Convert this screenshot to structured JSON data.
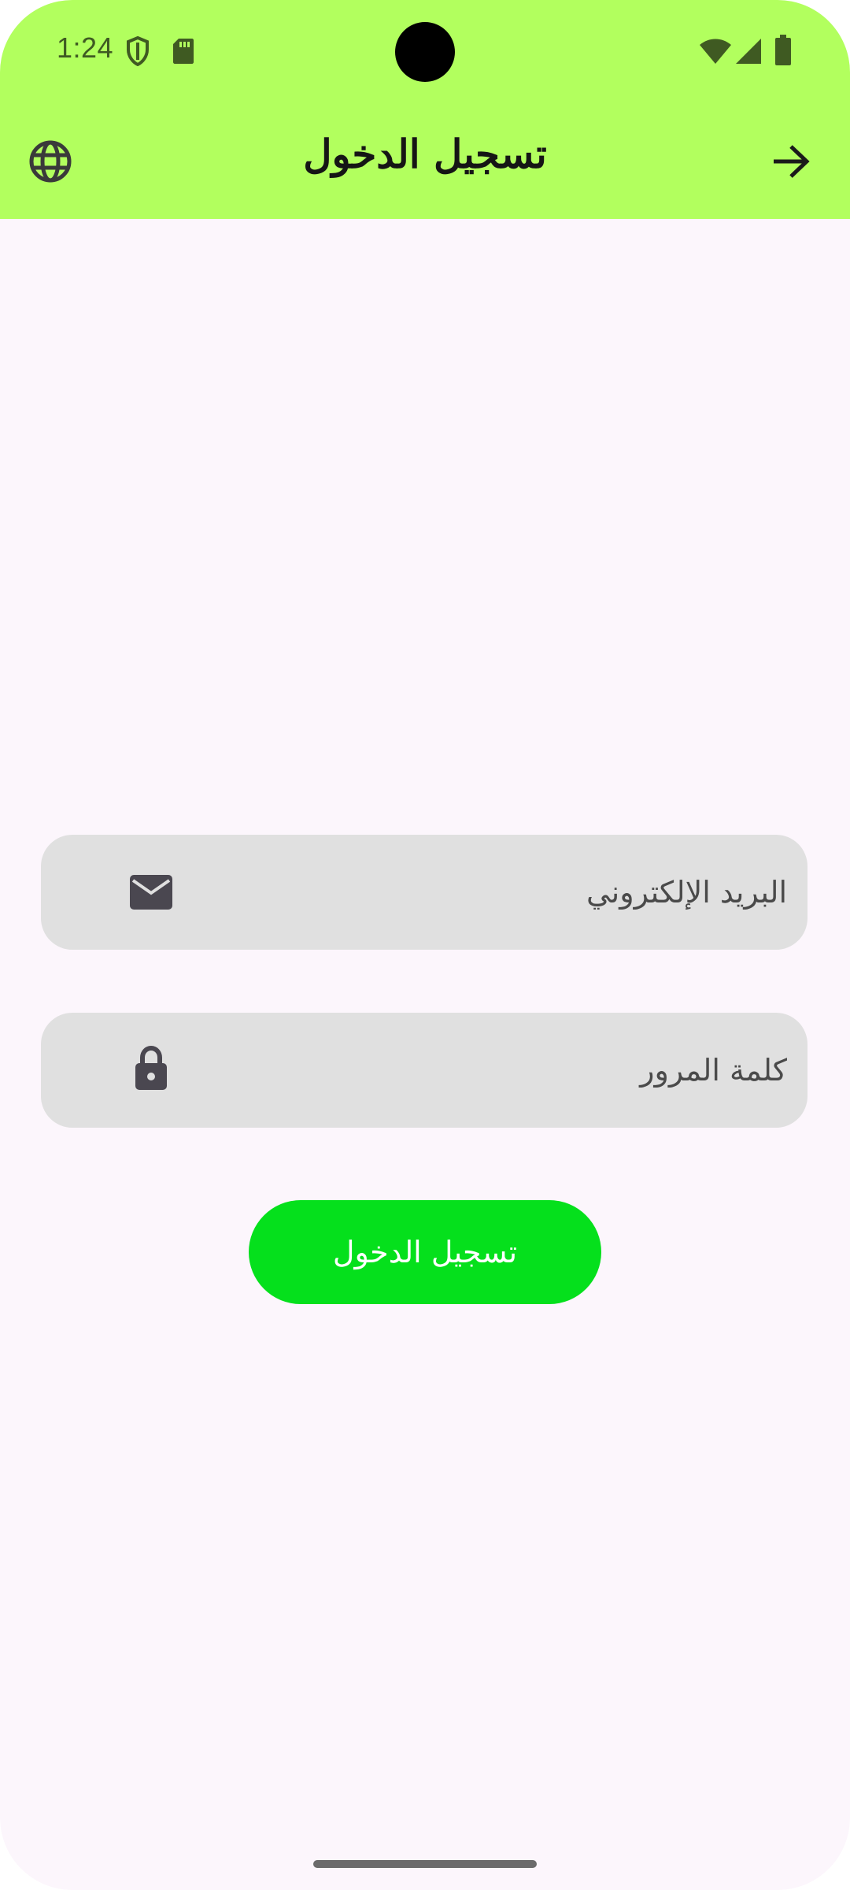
{
  "status_bar": {
    "time": "1:24",
    "icons": [
      "shield-icon",
      "sd-card-icon",
      "wifi-icon",
      "signal-icon",
      "battery-icon"
    ]
  },
  "app_bar": {
    "title": "تسجيل الدخول",
    "left_icon": "globe-icon",
    "right_icon": "arrow-forward-icon"
  },
  "form": {
    "email": {
      "placeholder": "البريد الإلكتروني",
      "value": "",
      "icon": "email-icon"
    },
    "password": {
      "placeholder": "كلمة المرور",
      "value": "",
      "icon": "lock-icon"
    },
    "submit_label": "تسجيل الدخول"
  },
  "colors": {
    "app_bar": "#b2ff5e",
    "background": "#fcf6fc",
    "field_bg": "#e0e0e0",
    "button": "#05e01c",
    "button_text": "#ffffff"
  }
}
